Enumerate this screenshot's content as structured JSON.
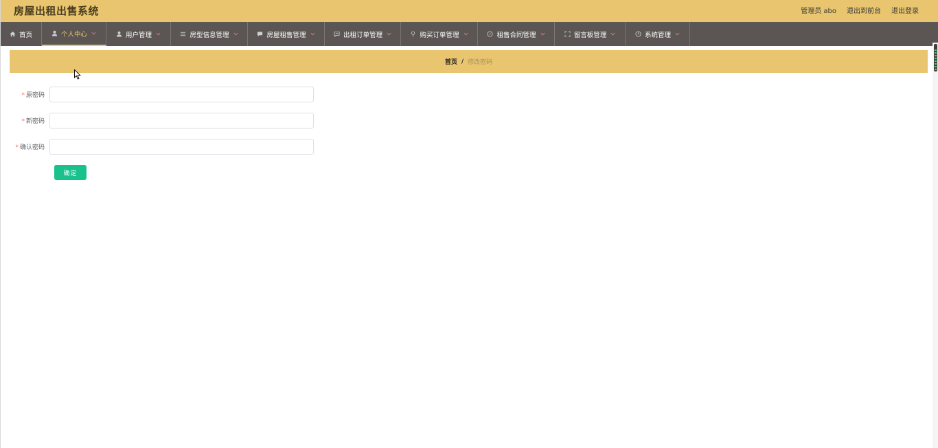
{
  "header": {
    "title": "房屋出租出售系统",
    "user_label": "管理员 abo",
    "front_link": "退出到前台",
    "logout_link": "退出登录"
  },
  "nav": {
    "items": [
      {
        "label": "首页",
        "icon": "home-icon"
      },
      {
        "label": "个人中心",
        "icon": "user-icon"
      },
      {
        "label": "用户管理",
        "icon": "user-icon"
      },
      {
        "label": "房型信息管理",
        "icon": "list-icon"
      },
      {
        "label": "房屋租售管理",
        "icon": "chat-icon"
      },
      {
        "label": "出租订单管理",
        "icon": "message-icon"
      },
      {
        "label": "购买订单管理",
        "icon": "location-icon"
      },
      {
        "label": "租售合同管理",
        "icon": "compass-icon"
      },
      {
        "label": "留言板管理",
        "icon": "fullscreen-icon"
      },
      {
        "label": "系统管理",
        "icon": "clock-icon"
      }
    ],
    "active_index": 1
  },
  "breadcrumb": {
    "home": "首页",
    "separator": "/",
    "current": "修改密码"
  },
  "form": {
    "old_password_label": "原密码",
    "new_password_label": "新密码",
    "confirm_password_label": "确认密码",
    "required_mark": "*",
    "old_password_value": "",
    "new_password_value": "",
    "confirm_password_value": "",
    "submit_label": "确定"
  },
  "colors": {
    "header_bg": "#e8c56e",
    "nav_bg": "#5b5654",
    "active_nav": "#e8c56e",
    "submit_bg": "#19c28c",
    "required": "#f56c6c"
  }
}
